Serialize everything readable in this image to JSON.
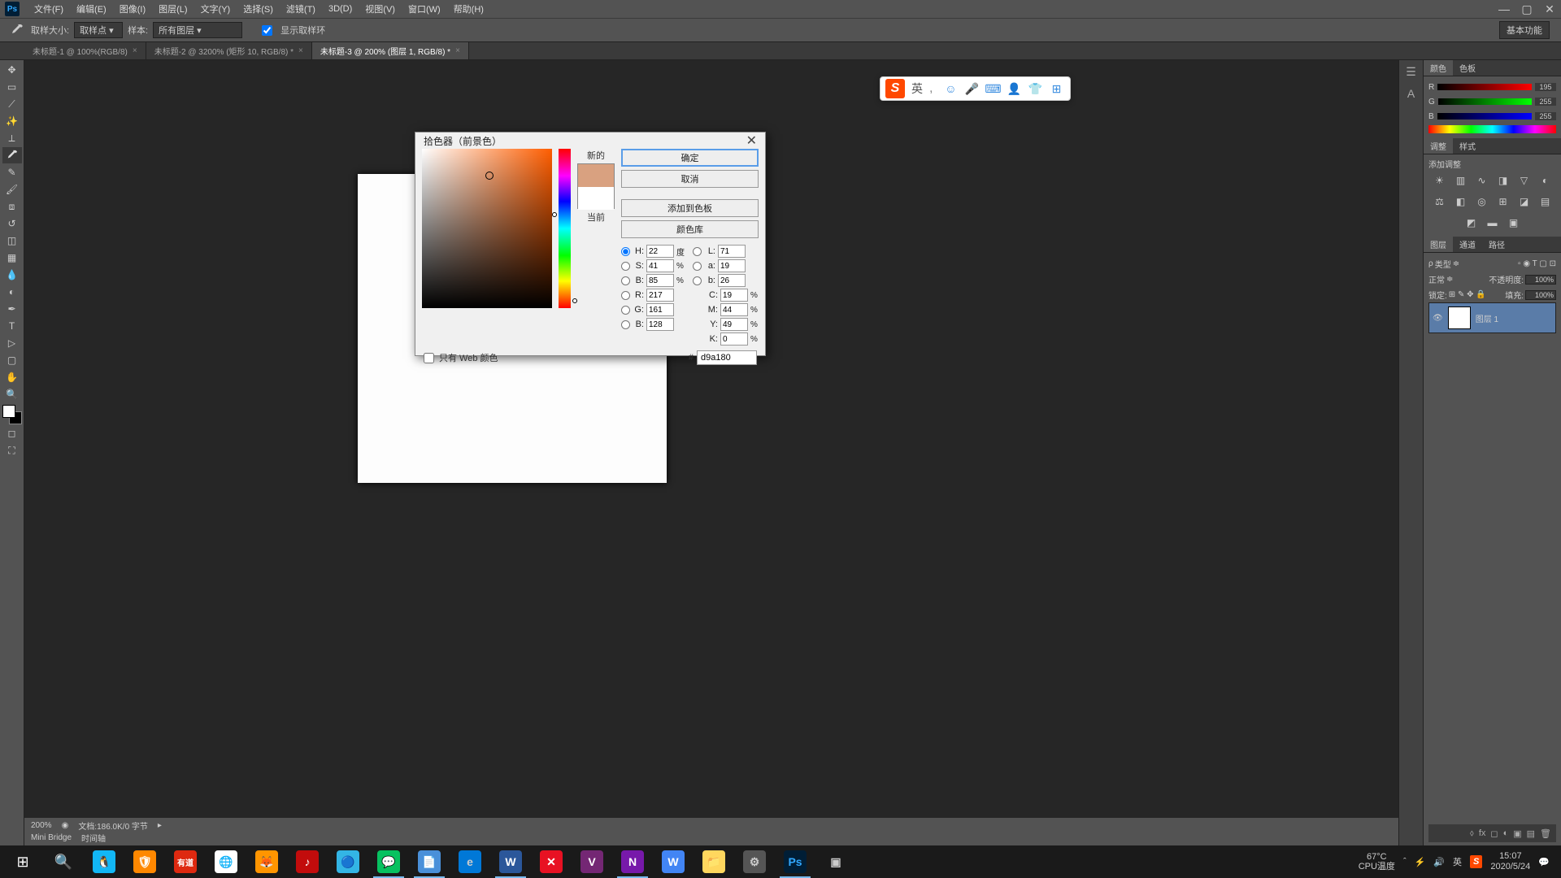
{
  "menu": {
    "items": [
      "文件(F)",
      "编辑(E)",
      "图像(I)",
      "图层(L)",
      "文字(Y)",
      "选择(S)",
      "滤镜(T)",
      "3D(D)",
      "视图(V)",
      "窗口(W)",
      "帮助(H)"
    ]
  },
  "options": {
    "sample_size_label": "取样大小:",
    "sample_size_value": "取样点",
    "sample_label": "样本:",
    "sample_value": "所有图层",
    "show_ring": "显示取样环",
    "basic": "基本功能"
  },
  "tabs": [
    {
      "label": "未标题-1 @ 100%(RGB/8)"
    },
    {
      "label": "未标题-2 @ 3200% (矩形 10, RGB/8) *"
    },
    {
      "label": "未标题-3 @ 200% (图层 1, RGB/8) *",
      "active": true
    }
  ],
  "status": {
    "zoom": "200%",
    "docinfo": "文档:186.0K/0 字节",
    "mini": "Mini Bridge",
    "timeline": "时间轴"
  },
  "picker": {
    "title": "拾色器（前景色）",
    "new_label": "新的",
    "current_label": "当前",
    "ok": "确定",
    "cancel": "取消",
    "add_swatch": "添加到色板",
    "color_lib": "颜色库",
    "web_only": "只有 Web 颜色",
    "hex": "d9a180",
    "H": "22",
    "S": "41",
    "B": "85",
    "R": "217",
    "G": "161",
    "Bb": "128",
    "L": "71",
    "a": "19",
    "b2": "26",
    "C": "19",
    "M": "44",
    "Y": "49",
    "K": "0"
  },
  "rightpanel": {
    "color_tab": "颜色",
    "swatch_tab": "色板",
    "R": "195",
    "G": "255",
    "B": "255",
    "adjust_tab": "调整",
    "styles_tab": "样式",
    "add_adj": "添加调整",
    "layers_tab": "图层",
    "channels_tab": "通道",
    "paths_tab": "路径",
    "kind": "类型",
    "normal": "正常",
    "opacity_label": "不透明度:",
    "opacity": "100%",
    "lock_label": "锁定:",
    "fill_label": "填充:",
    "fill": "100%",
    "layer1": "图层 1"
  },
  "ime": {
    "lang": "英"
  },
  "tray": {
    "temp": "67°C",
    "temp_label": "CPU温度",
    "ime": "英",
    "time": "15:07",
    "date": "2020/5/24"
  }
}
